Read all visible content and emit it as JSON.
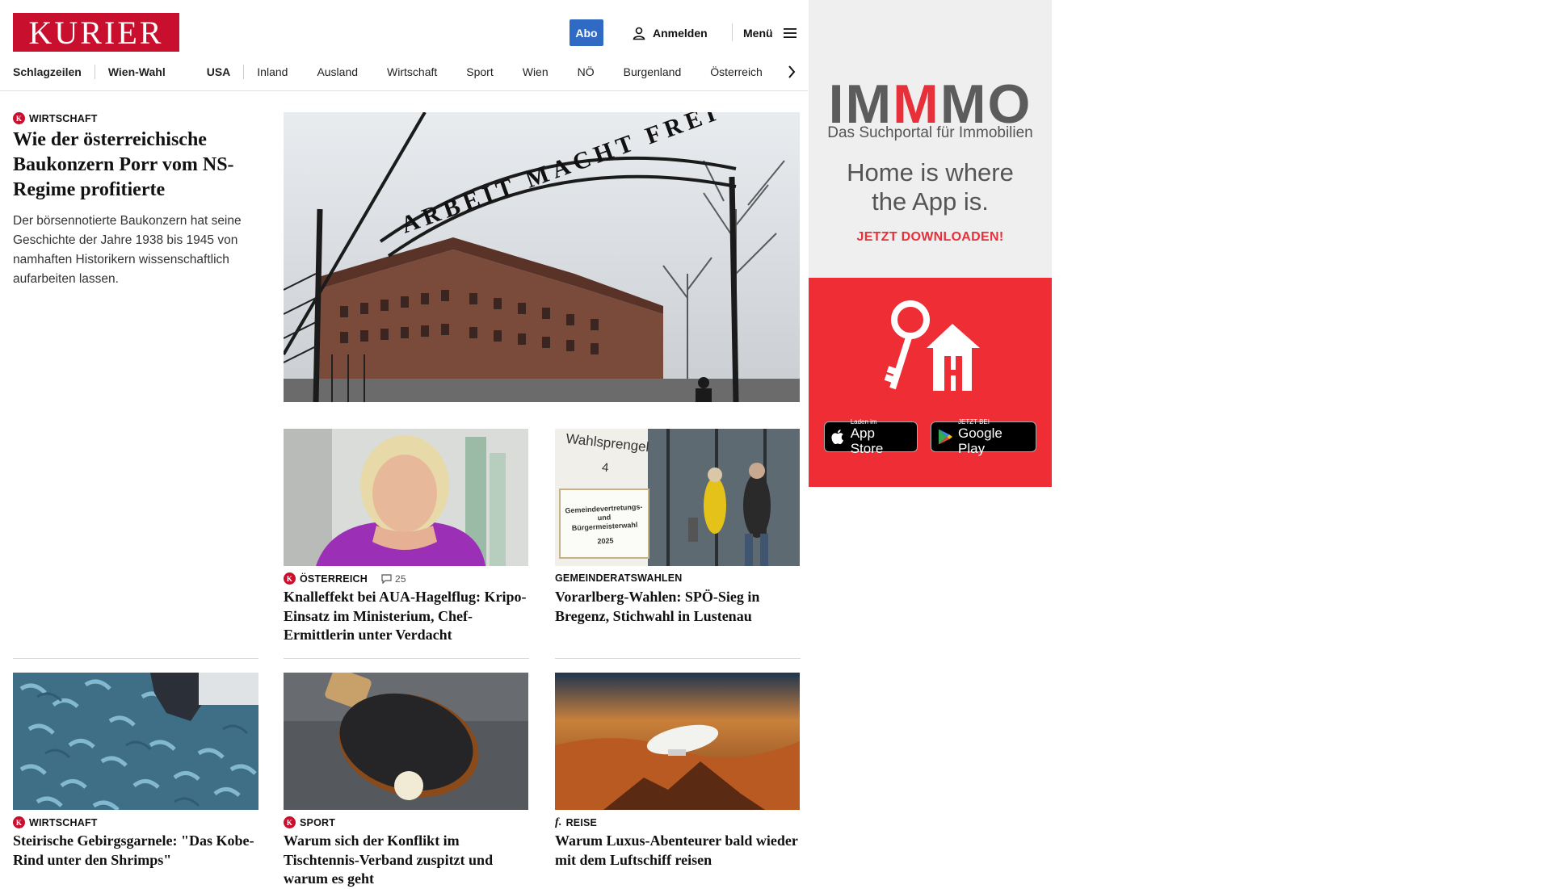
{
  "header": {
    "logo": "KURIER",
    "abo_label": "Abo",
    "login_label": "Anmelden",
    "menu_label": "Menü"
  },
  "nav": {
    "items": [
      "Schlagzeilen",
      "Wien-Wahl",
      "USA",
      "Inland",
      "Ausland",
      "Wirtschaft",
      "Sport",
      "Wien",
      "NÖ",
      "Burgenland",
      "Österreich"
    ]
  },
  "lead": {
    "badge": "K",
    "kicker": "WIRTSCHAFT",
    "headline": "Wie der österreichische Baukonzern Porr vom NS-Regime profitierte",
    "teaser": "Der börsennotierte Baukonzern hat seine Geschichte der Jahre 1938 bis 1945 von namhaften Historikern wissenschaftlich aufarbeiten lassen.",
    "image_sign_text": "ARBEIT MACHT FREI"
  },
  "grid": [
    {
      "badge": "K",
      "kicker": "ÖSTERREICH",
      "comments": "25",
      "headline": "Knalleffekt bei AUA-Hagelflug: Kripo-Einsatz im Ministerium, Chef-Ermittlerin unter Verdacht"
    },
    {
      "kicker": "GEMEINDERATSWAHLEN",
      "headline": "Vorarlberg-Wahlen: SPÖ-Sieg in Bregenz, Stichwahl in Lustenau",
      "image_sign": {
        "line1": "Wahlsprengel",
        "line2": "4",
        "line3": "Gemeindevertretungs-",
        "line4": "und",
        "line5": "Bürgermeisterwahl",
        "line6": "2025"
      }
    },
    {
      "badge": "K",
      "kicker": "WIRTSCHAFT",
      "headline": "Steirische Gebirgsgarnele: \"Das Kobe-Rind unter den Shrimps\""
    },
    {
      "badge": "K",
      "kicker": "SPORT",
      "headline": "Warum sich der Konflikt im Tischtennis-Verband zuspitzt und warum es geht"
    },
    {
      "badge": "f.",
      "kicker": "REISE",
      "headline": "Warum Luxus-Abenteurer bald wieder mit dem Luftschiff reisen"
    }
  ],
  "ad": {
    "logo_pre": "IM",
    "logo_mid": "M",
    "logo_post": "MO",
    "subtitle": "Das Suchportal für Immobilien",
    "claim_line1": "Home is where",
    "claim_line2": "the App is.",
    "cta": "JETZT DOWNLOADEN!",
    "appstore_small": "Laden im",
    "appstore_big": "App Store",
    "google_small": "JETZT BEI",
    "google_big": "Google Play"
  },
  "colors": {
    "brand_red": "#c8102e",
    "abo_blue": "#2f6bc5",
    "ad_red": "#ee2e34"
  }
}
